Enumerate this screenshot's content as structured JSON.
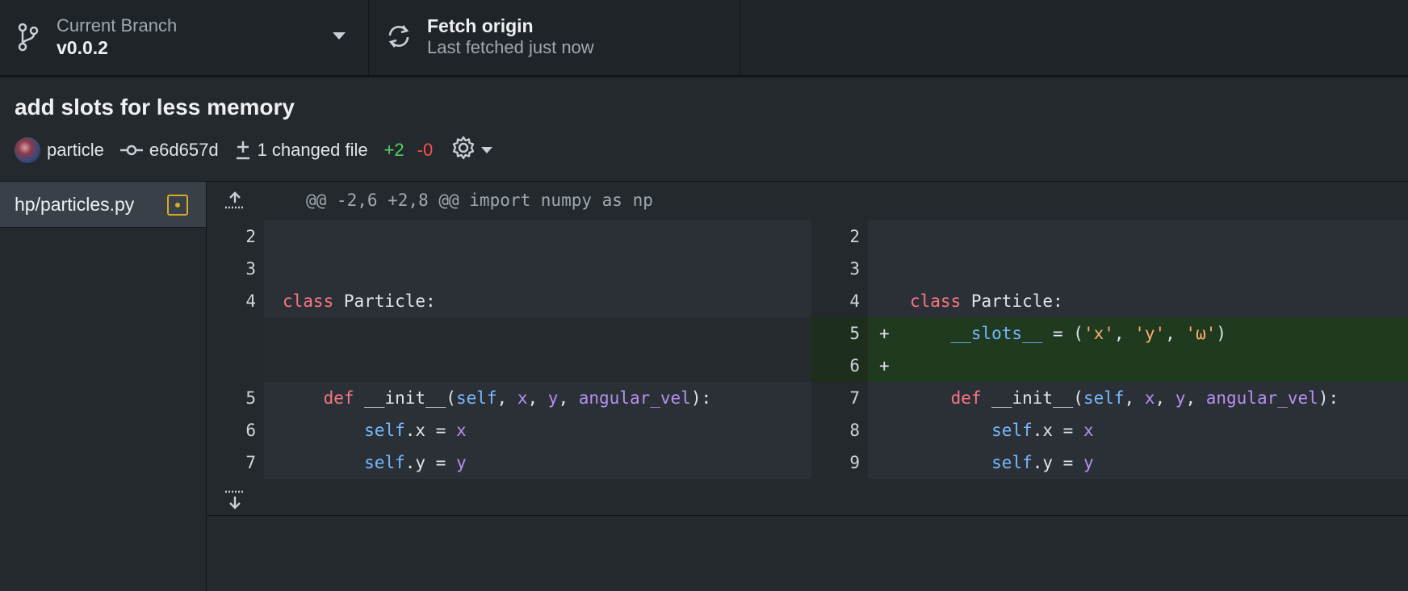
{
  "toolbar": {
    "branch": {
      "title": "Current Branch",
      "value": "v0.0.2"
    },
    "fetch": {
      "title": "Fetch origin",
      "value": "Last fetched just now"
    }
  },
  "commit": {
    "title": "add slots for less memory",
    "author": "particle",
    "sha": "e6d657d",
    "files_changed": "1 changed file",
    "additions": "+2",
    "deletions": "-0"
  },
  "sidebar": {
    "files": [
      {
        "name": "hp/particles.py",
        "status": "modified"
      }
    ]
  },
  "diff": {
    "hunk_header": "@@ -2,6 +2,8 @@ import numpy as np",
    "lines": {
      "l2": "2",
      "l3": "3",
      "l4": "4",
      "l5": "5",
      "l6": "6",
      "l7": "7",
      "r2": "2",
      "r3": "3",
      "r4": "4",
      "r5": "5",
      "r6": "6",
      "r7": "7",
      "r8": "8",
      "r9": "9"
    },
    "markers": {
      "add": "+"
    }
  },
  "colors": {
    "added_text": "#56d364",
    "removed_text": "#f85149",
    "added_line_bg": "#1f3a1f",
    "modified_badge": "#d9a829"
  },
  "icons": {
    "branch": "git-branch-icon",
    "fetch": "sync-icon",
    "commit": "git-commit-icon",
    "diff": "file-diff-icon",
    "settings": "gear-icon",
    "expand_up": "expand-up-icon",
    "expand_down": "expand-down-icon"
  }
}
